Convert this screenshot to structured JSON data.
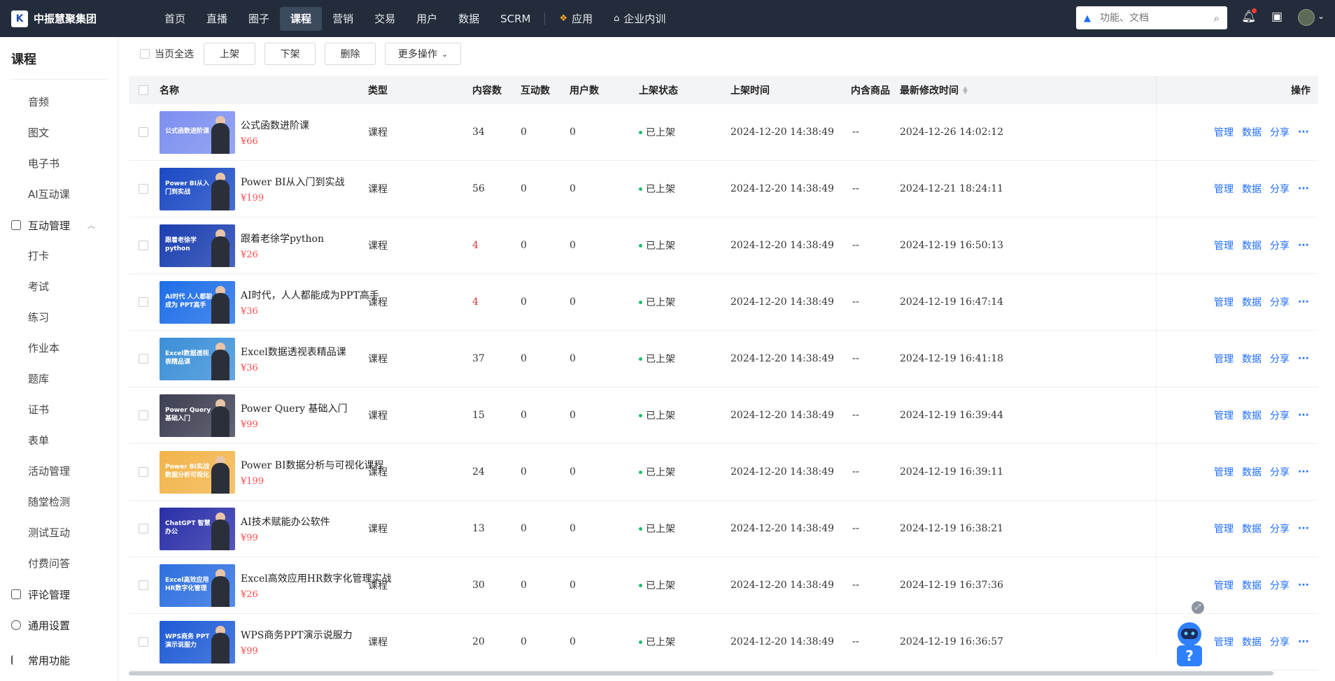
{
  "brand": {
    "name": "中振慧聚集团",
    "logo_text": "K"
  },
  "nav": {
    "items": [
      "首页",
      "直播",
      "圈子",
      "课程",
      "营销",
      "交易",
      "用户",
      "数据",
      "SCRM"
    ],
    "active": "课程",
    "apps_label": "应用",
    "training_label": "企业内训"
  },
  "search": {
    "placeholder": "功能、文档"
  },
  "sidebar": {
    "title": "课程",
    "top_items": [
      "音频",
      "图文",
      "电子书",
      "AI互动课"
    ],
    "group_interactive": "互动管理",
    "interactive_items": [
      "打卡",
      "考试",
      "练习",
      "作业本",
      "题库",
      "证书",
      "表单",
      "活动管理",
      "随堂检测",
      "测试互动",
      "付费问答"
    ],
    "group_comments": "评论管理",
    "group_settings": "通用设置",
    "group_common": "常用功能"
  },
  "toolbar": {
    "select_all": "当页全选",
    "publish": "上架",
    "unpublish": "下架",
    "delete": "删除",
    "more": "更多操作"
  },
  "table": {
    "headers": {
      "name": "名称",
      "type": "类型",
      "content_count": "内容数",
      "interaction_count": "互动数",
      "user_count": "用户数",
      "status": "上架状态",
      "publish_time": "上架时间",
      "includes_goods": "内含商品",
      "modified_time": "最新修改时间",
      "actions": "操作"
    },
    "action_labels": {
      "manage": "管理",
      "data": "数据",
      "share": "分享",
      "more": "···"
    },
    "rows": [
      {
        "title": "公式函数进阶课",
        "price": "¥66",
        "type": "课程",
        "content": "34",
        "interact": "0",
        "users": "0",
        "status": "已上架",
        "pub": "2024-12-20 14:38:49",
        "goods": "--",
        "mod": "2024-12-26 14:02:12",
        "thumb_text": "公式函数进阶课",
        "thumb_color": "#7c8ff0"
      },
      {
        "title": "Power BI从入门到实战",
        "price": "¥199",
        "type": "课程",
        "content": "56",
        "interact": "0",
        "users": "0",
        "status": "已上架",
        "pub": "2024-12-20 14:38:49",
        "goods": "--",
        "mod": "2024-12-21 18:24:11",
        "thumb_text": "Power BI从入门到实战",
        "thumb_color": "#1a49c4"
      },
      {
        "title": "跟着老徐学python",
        "price": "¥26",
        "type": "课程",
        "content": "4",
        "interact": "0",
        "users": "0",
        "status": "已上架",
        "pub": "2024-12-20 14:38:49",
        "goods": "--",
        "mod": "2024-12-19 16:50:13",
        "thumb_text": "跟着老徐学 python",
        "thumb_color": "#1b3fb0"
      },
      {
        "title": "AI时代，人人都能成为PPT高手",
        "price": "¥36",
        "type": "课程",
        "content": "4",
        "interact": "0",
        "users": "0",
        "status": "已上架",
        "pub": "2024-12-20 14:38:49",
        "goods": "--",
        "mod": "2024-12-19 16:47:14",
        "thumb_text": "AI时代 人人都能成为 PPT高手",
        "thumb_color": "#1e6ee8"
      },
      {
        "title": "Excel数据透视表精品课",
        "price": "¥36",
        "type": "课程",
        "content": "37",
        "interact": "0",
        "users": "0",
        "status": "已上架",
        "pub": "2024-12-20 14:38:49",
        "goods": "--",
        "mod": "2024-12-19 16:41:18",
        "thumb_text": "Excel数据透视表精品课",
        "thumb_color": "#3b8fd8"
      },
      {
        "title": "Power Query 基础入门",
        "price": "¥99",
        "type": "课程",
        "content": "15",
        "interact": "0",
        "users": "0",
        "status": "已上架",
        "pub": "2024-12-20 14:38:49",
        "goods": "--",
        "mod": "2024-12-19 16:39:44",
        "thumb_text": "Power Query 基础入门",
        "thumb_color": "#3d3f52"
      },
      {
        "title": "Power BI数据分析与可视化课程",
        "price": "¥199",
        "type": "课程",
        "content": "24",
        "interact": "0",
        "users": "0",
        "status": "已上架",
        "pub": "2024-12-20 14:38:49",
        "goods": "--",
        "mod": "2024-12-19 16:39:11",
        "thumb_text": "Power BI实战 数据分析可视化",
        "thumb_color": "#f2b44a"
      },
      {
        "title": "AI技术赋能办公软件",
        "price": "¥99",
        "type": "课程",
        "content": "13",
        "interact": "0",
        "users": "0",
        "status": "已上架",
        "pub": "2024-12-20 14:38:49",
        "goods": "--",
        "mod": "2024-12-19 16:38:21",
        "thumb_text": "ChatGPT 智慧办公",
        "thumb_color": "#2a2fa8"
      },
      {
        "title": "Excel高效应用HR数字化管理实战",
        "price": "¥26",
        "type": "课程",
        "content": "30",
        "interact": "0",
        "users": "0",
        "status": "已上架",
        "pub": "2024-12-20 14:38:49",
        "goods": "--",
        "mod": "2024-12-19 16:37:36",
        "thumb_text": "Excel高效应用 HR数字化管理",
        "thumb_color": "#2d6fe0"
      },
      {
        "title": "WPS商务PPT演示说服力",
        "price": "¥99",
        "type": "课程",
        "content": "20",
        "interact": "0",
        "users": "0",
        "status": "已上架",
        "pub": "2024-12-20 14:38:49",
        "goods": "--",
        "mod": "2024-12-19 16:36:57",
        "thumb_text": "WPS商务 PPT演示说服力",
        "thumb_color": "#1e5bd6"
      }
    ]
  }
}
